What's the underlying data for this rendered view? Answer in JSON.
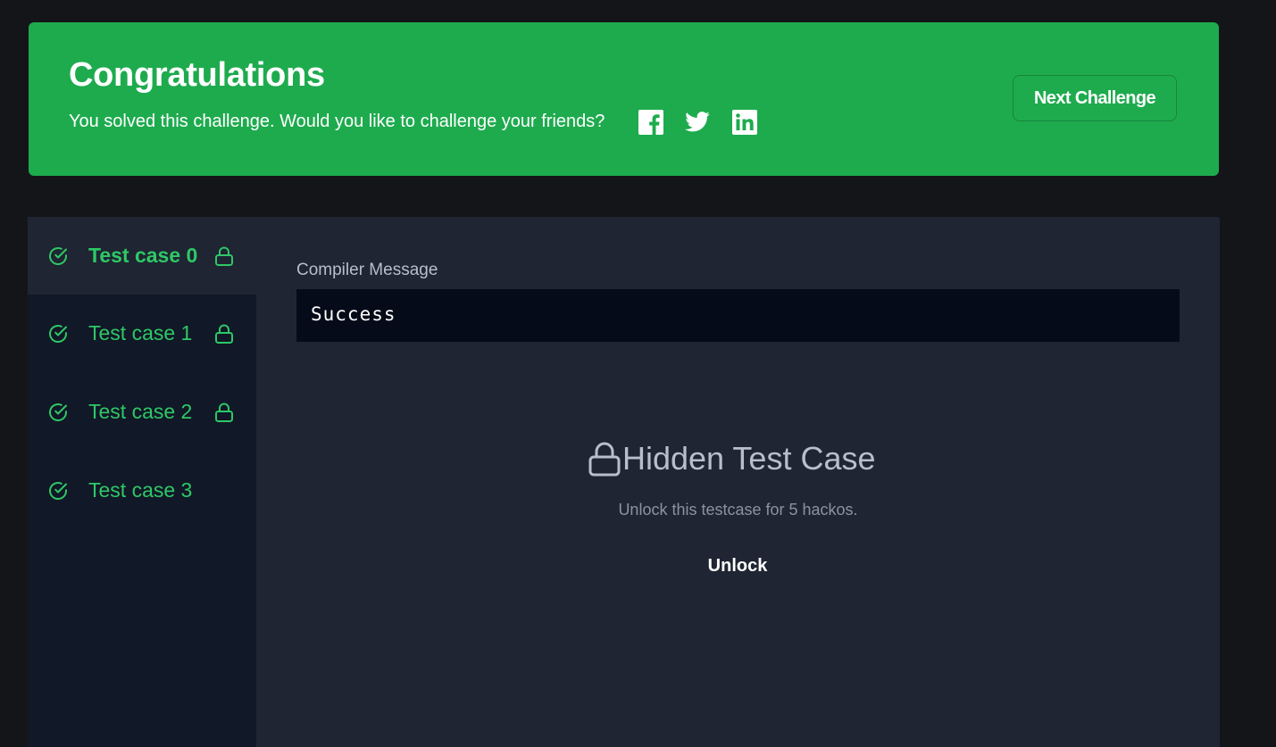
{
  "banner": {
    "title": "Congratulations",
    "message": "You solved this challenge. Would you like to challenge your friends?",
    "share_icons": [
      "facebook-icon",
      "twitter-icon",
      "linkedin-icon"
    ],
    "next_button": "Next Challenge",
    "color": "#1eab4e"
  },
  "test_cases": [
    {
      "label": "Test case 0",
      "status": "passed",
      "locked": true,
      "active": true
    },
    {
      "label": "Test case 1",
      "status": "passed",
      "locked": true,
      "active": false
    },
    {
      "label": "Test case 2",
      "status": "passed",
      "locked": true,
      "active": false
    },
    {
      "label": "Test case 3",
      "status": "passed",
      "locked": false,
      "active": false
    }
  ],
  "compiler": {
    "label": "Compiler Message",
    "message": "Success"
  },
  "hidden": {
    "title": "Hidden Test Case",
    "subtitle": "Unlock this testcase for 5 hackos.",
    "unlock_label": "Unlock"
  },
  "colors": {
    "accent_green": "#2ec866",
    "page_bg": "#141519",
    "panel_bg": "#1f2532",
    "sidebar_bg": "#111827"
  }
}
